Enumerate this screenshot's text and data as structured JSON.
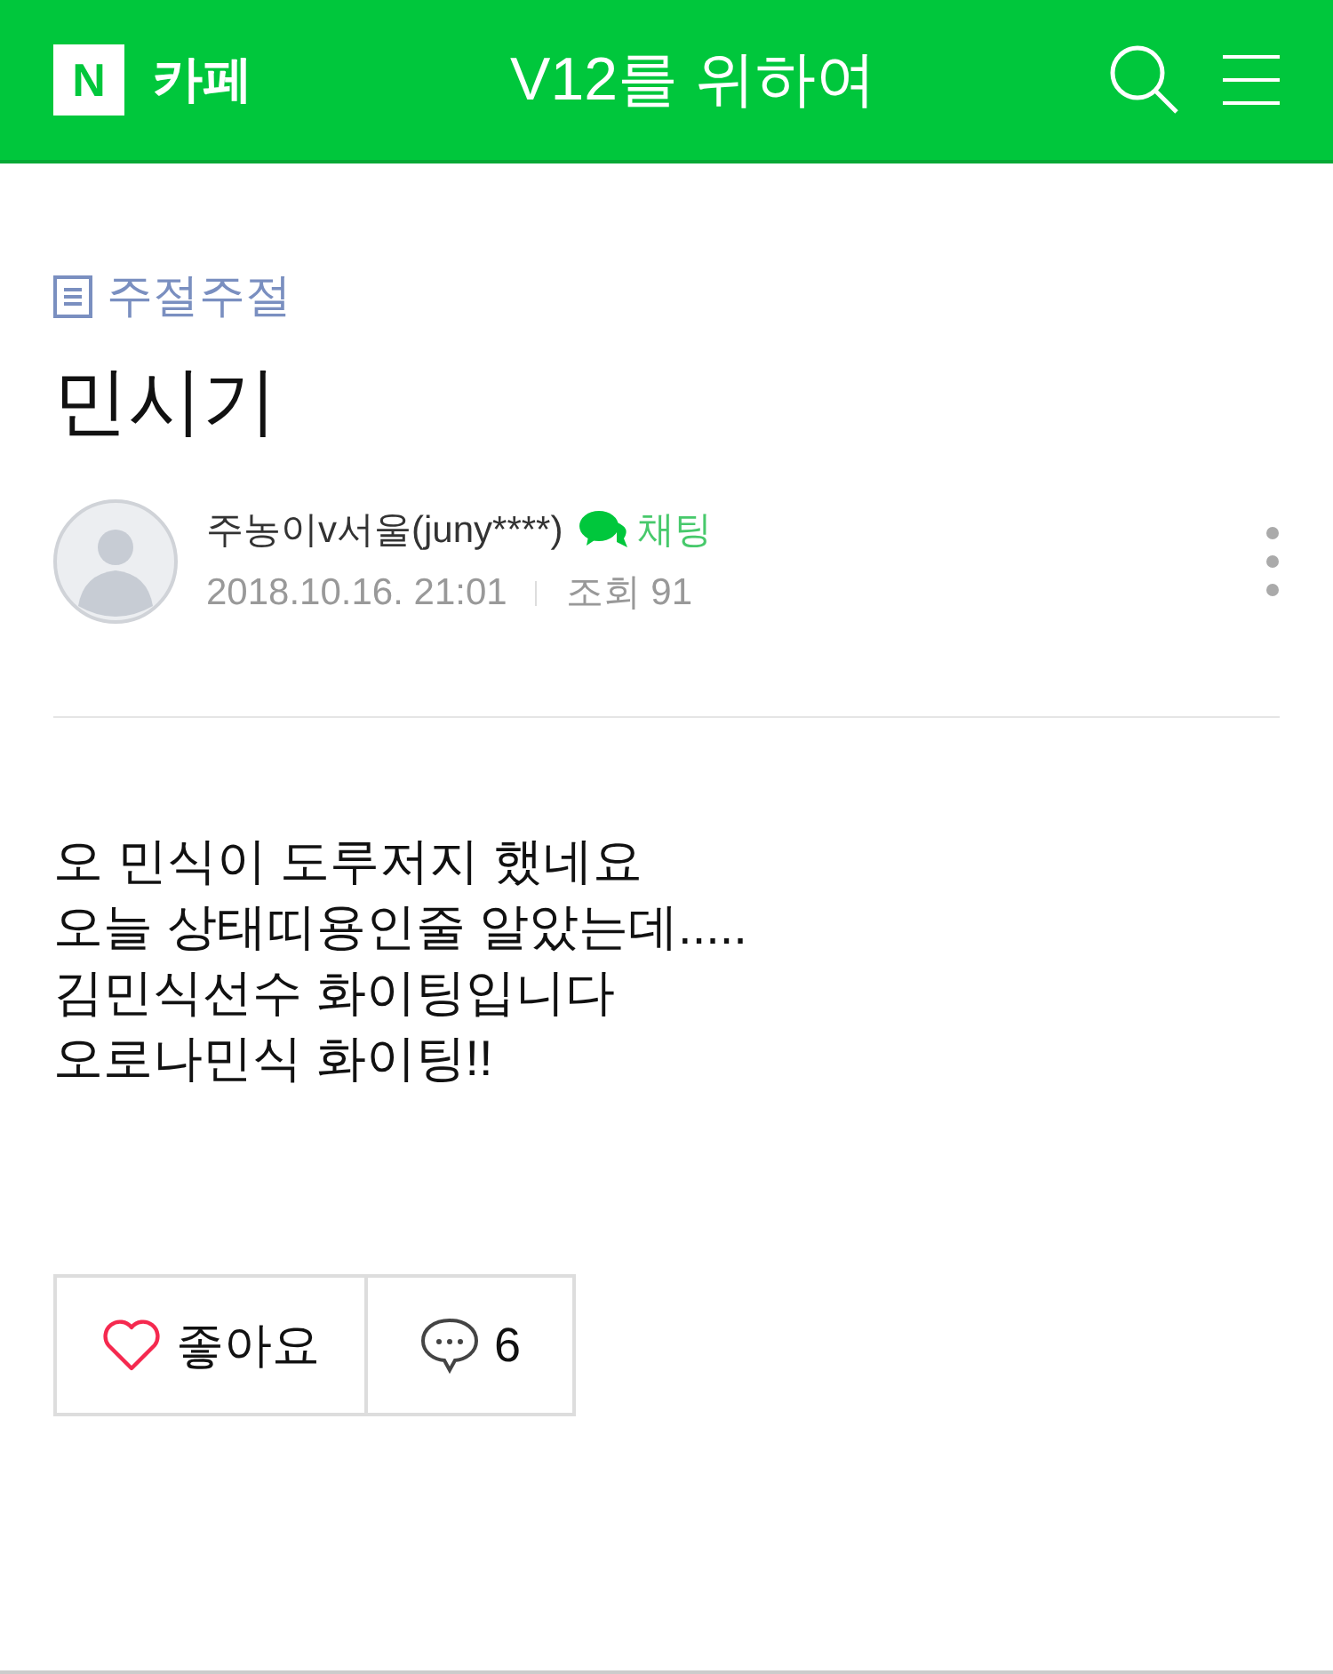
{
  "header": {
    "logo": "N",
    "service": "카페",
    "cafe_name": "V12를 위하여"
  },
  "post": {
    "category": "주절주절",
    "title": "민시기",
    "author": {
      "name": "주농이v서울(juny****)",
      "chat": "채팅",
      "date": "2018.10.16. 21:01",
      "views": "조회 91"
    },
    "body": [
      "오 민식이 도루저지 했네요",
      "오늘 상태띠용인줄 알았는데.....",
      "김민식선수 화이팅입니다",
      "오로나민식 화이팅!!"
    ]
  },
  "actions": {
    "like": {
      "label": "좋아요",
      "liked": false
    },
    "comments": {
      "count": "6"
    }
  }
}
